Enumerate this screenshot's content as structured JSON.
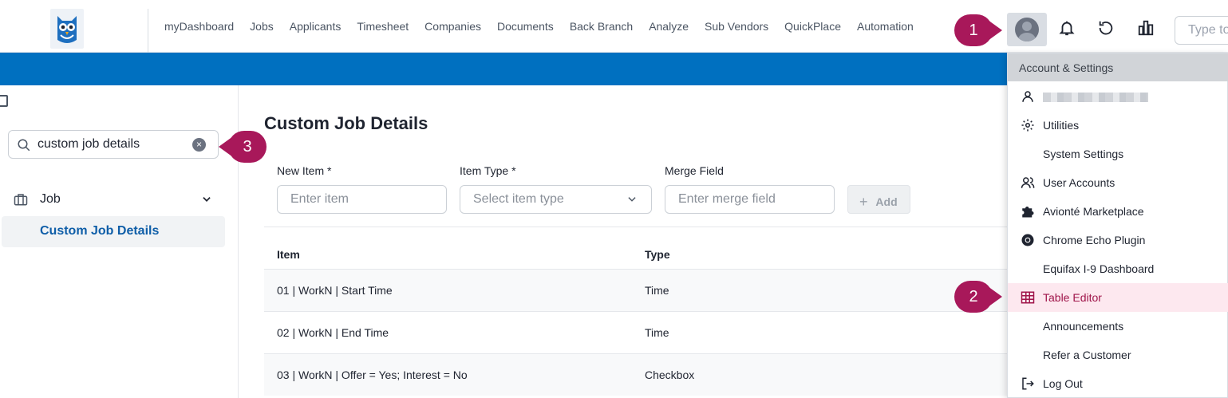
{
  "nav": {
    "items": [
      "myDashboard",
      "Jobs",
      "Applicants",
      "Timesheet",
      "Companies",
      "Documents",
      "Back Branch",
      "Analyze",
      "Sub Vendors",
      "QuickPlace",
      "Automation"
    ],
    "search_placeholder": "Type to"
  },
  "sidebar": {
    "search_value": "custom job details",
    "group_label": "Job",
    "active_item": "Custom Job Details"
  },
  "main": {
    "title": "Custom Job Details",
    "new_item_label": "New Item *",
    "new_item_placeholder": "Enter item",
    "item_type_label": "Item Type *",
    "item_type_placeholder": "Select item type",
    "merge_field_label": "Merge Field",
    "merge_field_placeholder": "Enter merge field",
    "add_label": "Add",
    "columns": [
      "Item",
      "Type"
    ],
    "rows": [
      {
        "item": "01 | WorkN | Start Time",
        "type": "Time"
      },
      {
        "item": "02 | WorkN | End Time",
        "type": "Time"
      },
      {
        "item": "03 | WorkN | Offer = Yes; Interest = No",
        "type": "Checkbox"
      }
    ]
  },
  "dropdown": {
    "header": "Account & Settings",
    "items": [
      {
        "label": "Utilities",
        "icon": "gear-icon"
      },
      {
        "label": "System Settings",
        "icon": ""
      },
      {
        "label": "User Accounts",
        "icon": "users-icon"
      },
      {
        "label": "Avionté Marketplace",
        "icon": "puzzle-icon"
      },
      {
        "label": "Chrome Echo Plugin",
        "icon": "chrome-icon"
      },
      {
        "label": "Equifax I-9 Dashboard",
        "icon": ""
      },
      {
        "label": "Table Editor",
        "icon": "table-icon"
      },
      {
        "label": "Announcements",
        "icon": ""
      },
      {
        "label": "Refer a Customer",
        "icon": ""
      },
      {
        "label": "Log Out",
        "icon": "logout-icon"
      }
    ]
  },
  "callouts": {
    "one": "1",
    "two": "2",
    "three": "3"
  },
  "colors": {
    "brand_blue": "#0070c0",
    "callout": "#a8185a",
    "active_bg": "#fde8ef"
  }
}
